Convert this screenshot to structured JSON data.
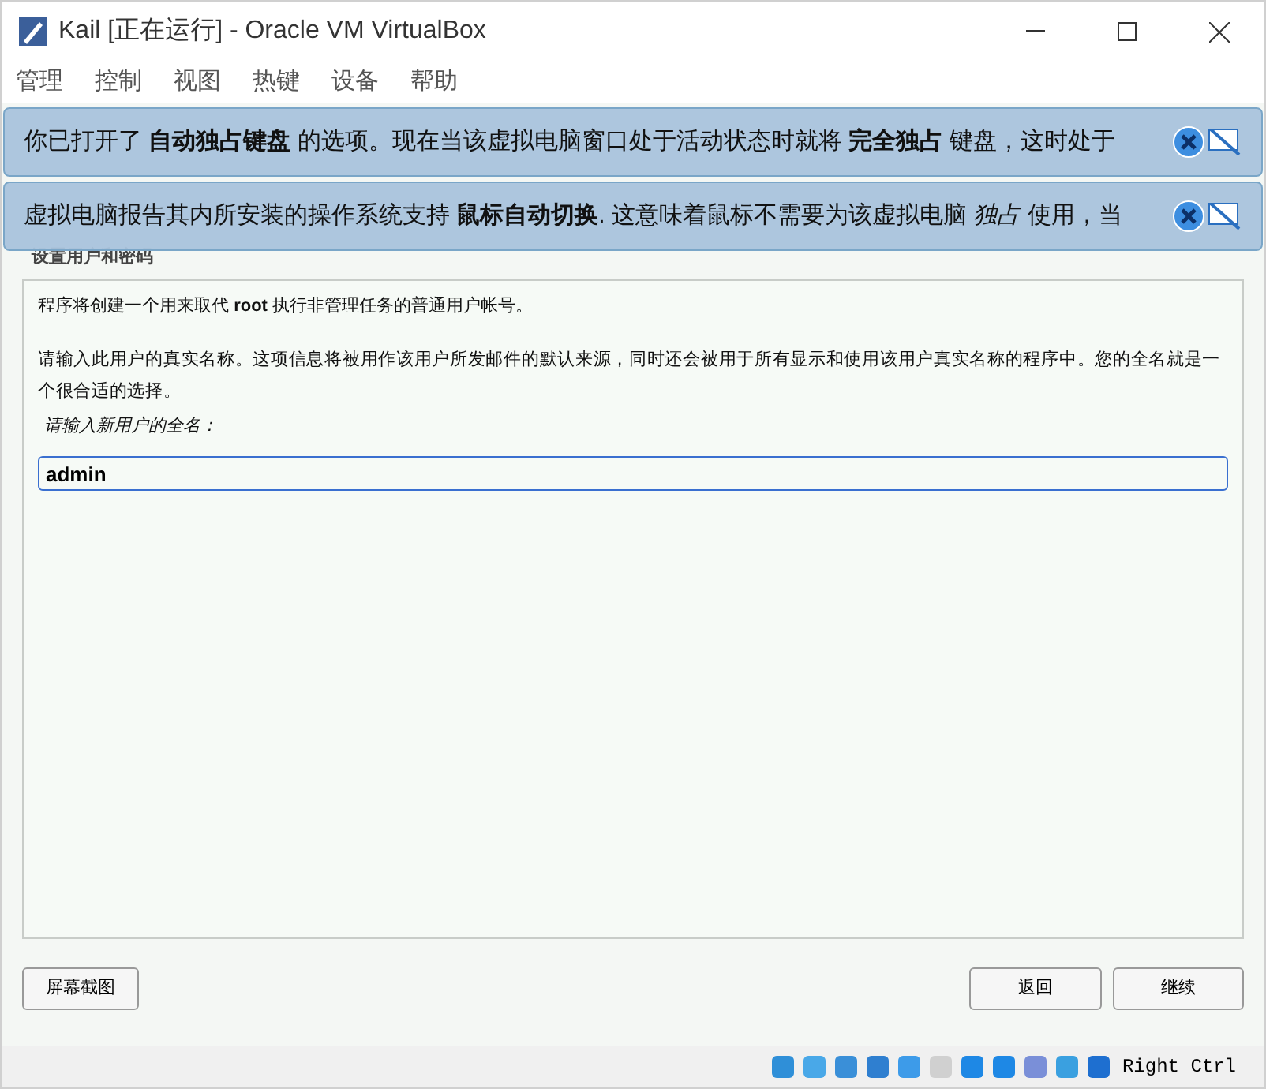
{
  "window": {
    "title": "Kail [正在运行] - Oracle VM VirtualBox"
  },
  "menu": [
    "管理",
    "控制",
    "视图",
    "热键",
    "设备",
    "帮助"
  ],
  "notifications": [
    {
      "text": "你已打开了 **自动独占键盘** 的选项。现在当该虚拟电脑窗口处于活动状态时就将 **完全独占** 键盘，这时处于"
    },
    {
      "text": "虚拟电脑报告其内所安装的操作系统支持 **鼠标自动切换**. 这意味着鼠标不需要为该虚拟电脑 *独占* 使用，当"
    }
  ],
  "installer": {
    "heading": "设置用户和密码",
    "intro": "程序将创建一个用来取代 **root** 执行非管理任务的普通用户帐号。",
    "description": "请输入此用户的真实名称。这项信息将被用作该用户所发邮件的默认来源，同时还会被用于所有显示和使用该用户真实名称的程序中。您的全名就是一个很合适的选择。",
    "prompt": "请输入新用户的全名：",
    "value": "admin",
    "buttons": {
      "screenshot": "屏幕截图",
      "back": "返回",
      "continue": "继续"
    }
  },
  "status_bar": {
    "host_key": "Right Ctrl"
  }
}
